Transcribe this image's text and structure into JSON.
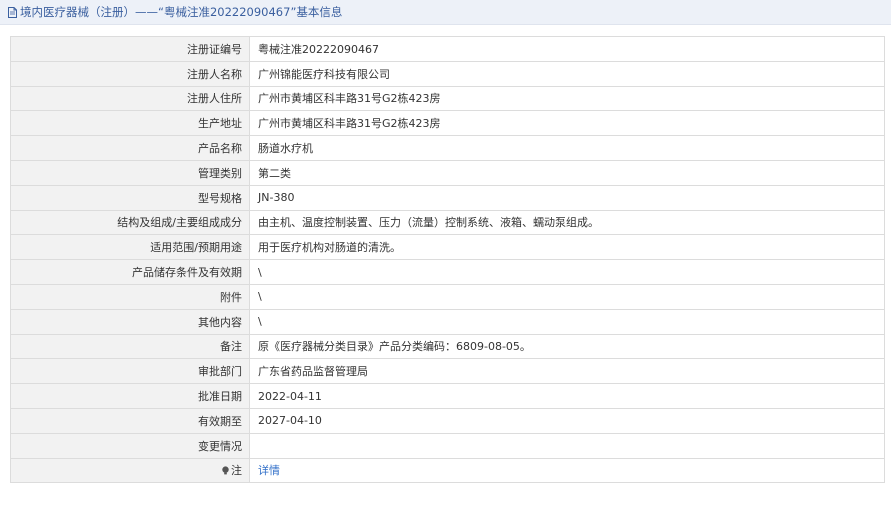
{
  "header": {
    "title": "境内医疗器械（注册）——“粤械注准20222090467”基本信息",
    "icon": "document-icon"
  },
  "rows": [
    {
      "label": "注册证编号",
      "value": "粤械注准20222090467"
    },
    {
      "label": "注册人名称",
      "value": "广州锦能医疗科技有限公司"
    },
    {
      "label": "注册人住所",
      "value": "广州市黄埔区科丰路31号G2栋423房"
    },
    {
      "label": "生产地址",
      "value": "广州市黄埔区科丰路31号G2栋423房"
    },
    {
      "label": "产品名称",
      "value": "肠道水疗机"
    },
    {
      "label": "管理类别",
      "value": "第二类"
    },
    {
      "label": "型号规格",
      "value": "JN-380"
    },
    {
      "label": "结构及组成/主要组成成分",
      "value": "由主机、温度控制装置、压力（流量）控制系统、液箱、蠕动泵组成。"
    },
    {
      "label": "适用范围/预期用途",
      "value": "用于医疗机构对肠道的清洗。"
    },
    {
      "label": "产品储存条件及有效期",
      "value": "\\"
    },
    {
      "label": "附件",
      "value": "\\"
    },
    {
      "label": "其他内容",
      "value": "\\"
    },
    {
      "label": "备注",
      "value": "原《医疗器械分类目录》产品分类编码：6809-08-05。"
    },
    {
      "label": "审批部门",
      "value": "广东省药品监督管理局"
    },
    {
      "label": "批准日期",
      "value": "2022-04-11"
    },
    {
      "label": "有效期至",
      "value": "2027-04-10"
    },
    {
      "label": "变更情况",
      "value": ""
    }
  ],
  "note_row": {
    "label": "注",
    "icon": "lightbulb-icon",
    "link_text": "详情"
  },
  "colors": {
    "header_bg": "#edf1f8",
    "title": "#3a5f9f",
    "label_bg": "#f2f2f2",
    "border": "#dcdcdc",
    "link": "#2f6ec8"
  }
}
